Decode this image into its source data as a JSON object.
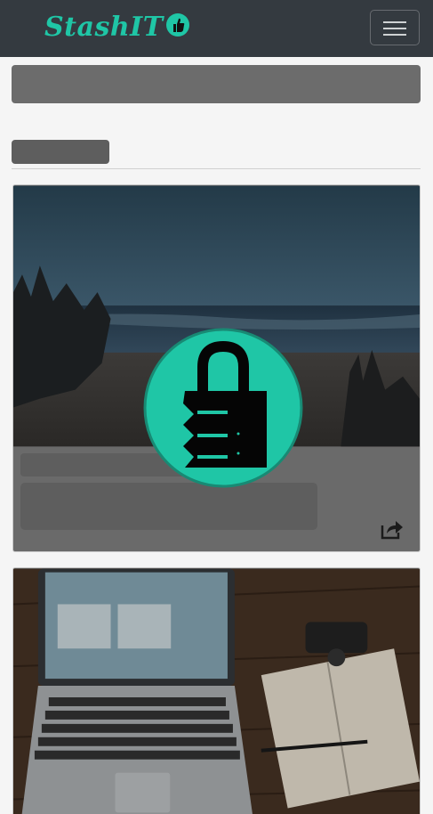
{
  "navbar": {
    "brand_text": "StashIT",
    "brand_color": "#1fc6a6",
    "background": "#343a40"
  },
  "icons": {
    "toggler": "hamburger-menu-icon",
    "brand": "thumbs-up-icon",
    "loading": "padlock-icon",
    "share": "share-icon"
  },
  "cards": [
    {
      "image": "beach-seascape-photo",
      "has_share": true
    },
    {
      "image": "laptop-notebook-desk-photo",
      "has_share": false
    }
  ],
  "colors": {
    "accent": "#1fc6a6",
    "placeholder": "#5e5e5e"
  }
}
